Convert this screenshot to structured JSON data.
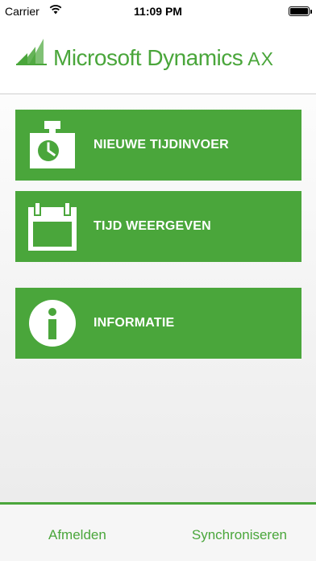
{
  "status_bar": {
    "carrier": "Carrier",
    "time": "11:09 PM"
  },
  "header": {
    "brand": "Microsoft Dynamics",
    "product": "AX"
  },
  "tiles": [
    {
      "label": "NIEUWE TIJDINVOER",
      "icon": "stopwatch-icon"
    },
    {
      "label": "TIJD WEERGEVEN",
      "icon": "calendar-icon"
    },
    {
      "label": "INFORMATIE",
      "icon": "info-icon"
    }
  ],
  "footer": {
    "signout_label": "Afmelden",
    "sync_label": "Synchroniseren"
  },
  "colors": {
    "accent": "#4aa63b",
    "tile_text": "#ffffff",
    "background": "#f3f3f3"
  }
}
